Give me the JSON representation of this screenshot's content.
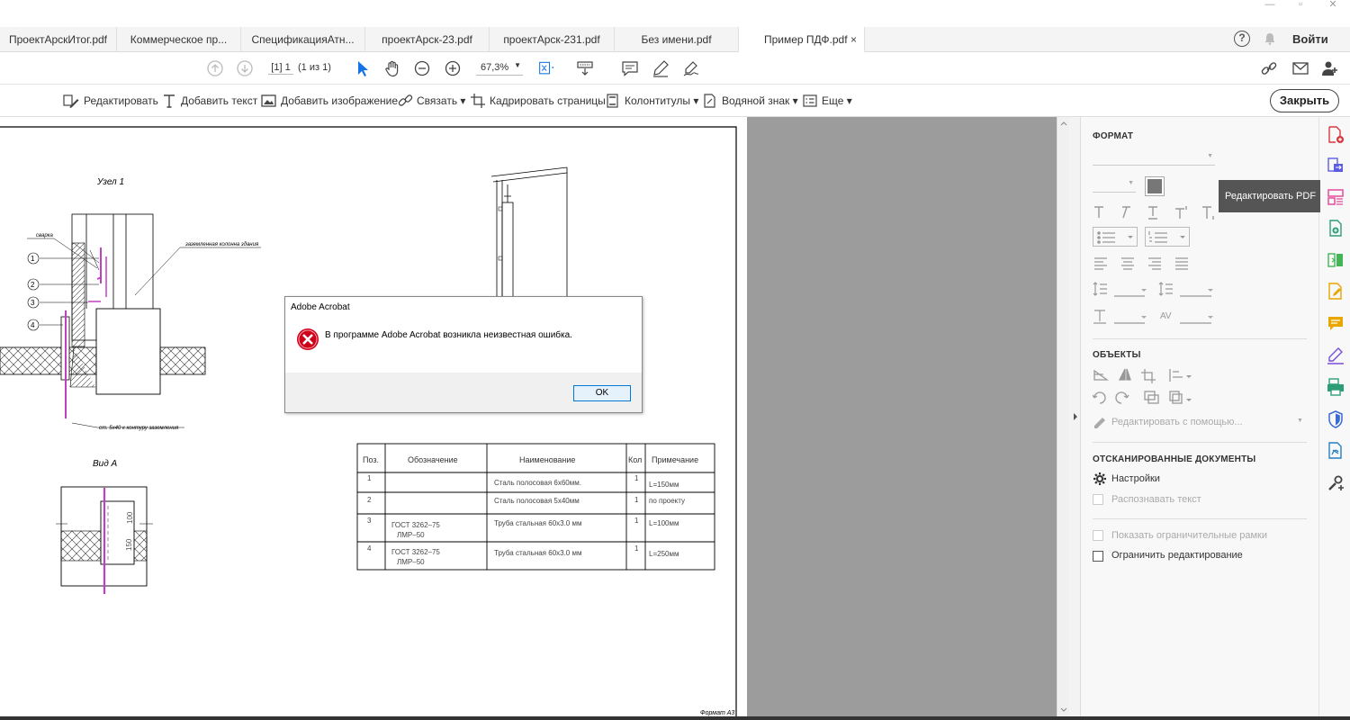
{
  "tabs": [
    {
      "label": "ПроектАрскИтог.pdf"
    },
    {
      "label": "Коммерческое пр..."
    },
    {
      "label": "СпецификацияАтн..."
    },
    {
      "label": "проектАрск-23.pdf"
    },
    {
      "label": "проектАрск-231.pdf"
    },
    {
      "label": "Без имени.pdf"
    },
    {
      "label": "Пример ПДФ.pdf",
      "close": "×"
    }
  ],
  "header": {
    "help": "?",
    "signin": "Войти"
  },
  "window_controls": {
    "minimize": "—",
    "restore": "▫",
    "close": "✕"
  },
  "toolbar": {
    "page_input": "[1] 1",
    "page_of": "(1 из 1)",
    "zoom": "67,3%",
    "zoom_dd": "▼"
  },
  "edit_tools": [
    {
      "label": "Редактировать"
    },
    {
      "label": "Добавить текст"
    },
    {
      "label": "Добавить изображение"
    },
    {
      "label": "Связать ▾"
    },
    {
      "label": "Кадрировать страницы"
    },
    {
      "label": "Колонтитулы ▾"
    },
    {
      "label": "Водяной знак ▾"
    },
    {
      "label": "Еще ▾"
    }
  ],
  "close_button": "Закрыть",
  "right_panel": {
    "format_title": "ФОРМАТ",
    "objects_title": "ОБЪЕКТЫ",
    "edit_with": "Редактировать с помощью...",
    "scanned_title": "ОТСКАНИРОВАННЫЕ ДОКУМЕНТЫ",
    "settings": "Настройки",
    "recognize": "Распознавать текст",
    "show_bounds": "Показать ограничительные рамки",
    "restrict_edit": "Ограничить редактирование"
  },
  "tooltip": "Редактировать PDF",
  "dialog": {
    "title": "Adobe Acrobat",
    "message": "В программе Adobe Acrobat возникла неизвестная ошибка.",
    "ok": "OK"
  },
  "drawing": {
    "node_title": "Узел 1",
    "view_title": "Вид А",
    "weld_label": "сварка",
    "column_label": "заземленная колонна здания",
    "ground_label": "ст. 5х40 к контуру заземления",
    "callouts": [
      "1",
      "2",
      "3",
      "4"
    ],
    "dim_100": "100",
    "dim_150": "150",
    "format_label": "Формат А3"
  },
  "spec_table": {
    "headers": [
      "Поз.",
      "Обозначение",
      "Наименование",
      "Кол",
      "Примечание"
    ],
    "rows": [
      [
        "1",
        "",
        "Сталь полосовая 6х60мм.",
        "1",
        "L=150мм"
      ],
      [
        "2",
        "",
        "Сталь полосовая 5х40мм",
        "1",
        "по проекту"
      ],
      [
        "3",
        "ГОСТ 3262–75|ЛМР–50",
        "Труба стальная 60х3.0 мм",
        "1",
        "L=100мм"
      ],
      [
        "4",
        "ГОСТ 3262–75|ЛМР–50",
        "Труба стальная 60х3.0 мм",
        "1",
        "L=250мм"
      ]
    ]
  },
  "colors": {
    "accent": "#1473e6",
    "error": "#d0021b",
    "tooltip_bg": "#555555",
    "doc_bg": "#9c9c9c"
  }
}
